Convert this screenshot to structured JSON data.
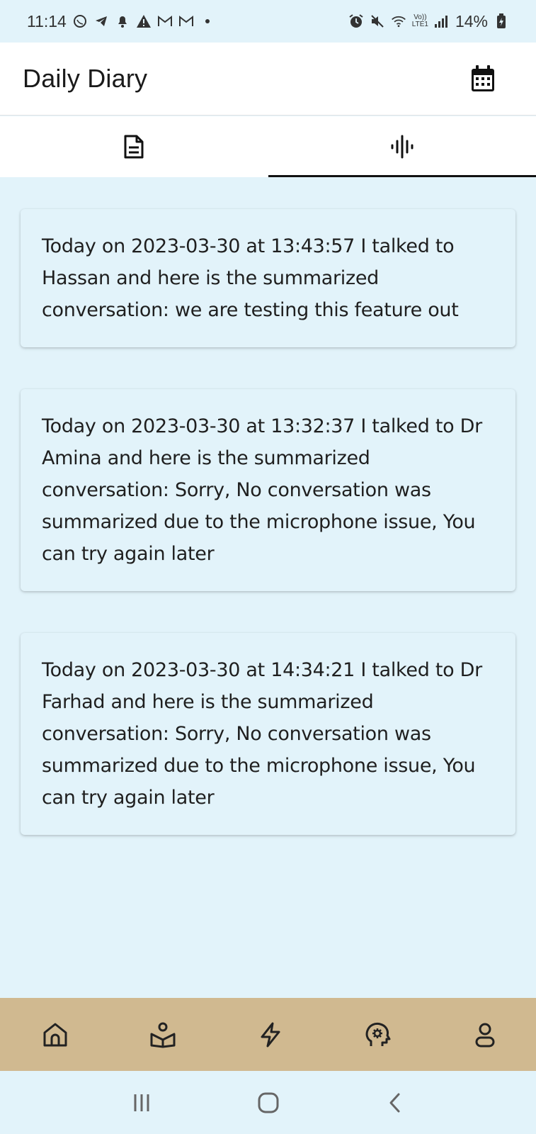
{
  "status_bar": {
    "time": "11:14",
    "battery": "14%",
    "network": "LTE1",
    "volte": "Vo))"
  },
  "app_bar": {
    "title": "Daily Diary",
    "calendar_icon": "calendar-icon"
  },
  "tabs": [
    {
      "icon": "document-icon",
      "active": false
    },
    {
      "icon": "audio-waveform-icon",
      "active": true
    }
  ],
  "entries": [
    {
      "text": "Today on 2023-03-30 at 13:43:57  I talked to Hassan and here is the summarized conversation: we are testing this feature out"
    },
    {
      "text": "Today on 2023-03-30 at 13:32:37  I talked to Dr Amina and here is the summarized conversation: Sorry, No conversation was summarized due to the microphone issue, You can try again later"
    },
    {
      "text": "Today on 2023-03-30 at 14:34:21  I talked to Dr Farhad and here is the summarized conversation: Sorry, No conversation was summarized due to the microphone issue, You can try again later"
    }
  ],
  "bottom_nav": [
    {
      "icon": "home-icon"
    },
    {
      "icon": "reading-icon"
    },
    {
      "icon": "lightning-icon"
    },
    {
      "icon": "mind-gear-icon"
    },
    {
      "icon": "profile-icon"
    }
  ],
  "colors": {
    "background": "#e2f3fa",
    "app_bar": "#ffffff",
    "bottom_nav": "#d0b990",
    "tab_indicator": "#111111"
  }
}
